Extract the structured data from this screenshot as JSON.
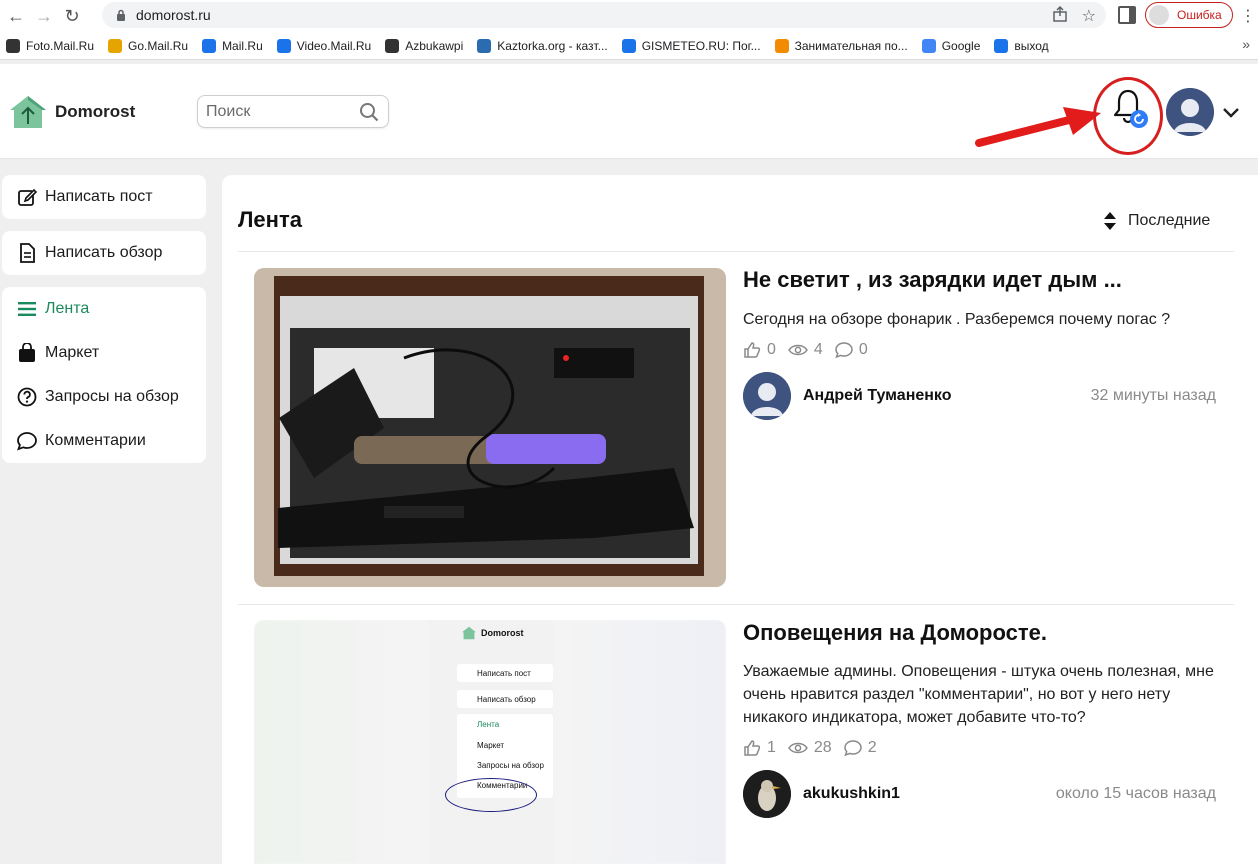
{
  "browser": {
    "url": "domorost.ru",
    "profile_status": "Ошибка",
    "bookmarks": [
      {
        "label": "Foto.Mail.Ru",
        "icon": "camera-icon",
        "color": "#333333"
      },
      {
        "label": "Go.Mail.Ru",
        "icon": "magnifier-icon",
        "color": "#e6a400"
      },
      {
        "label": "Mail.Ru",
        "icon": "at-icon",
        "color": "#1a73e8"
      },
      {
        "label": "Video.Mail.Ru",
        "icon": "video-icon",
        "color": "#1a73e8"
      },
      {
        "label": "Azbukawpi",
        "icon": "azbuka-icon",
        "color": "#333333"
      },
      {
        "label": "Kaztorka.org - казт...",
        "icon": "k-icon",
        "color": "#2b6cb0"
      },
      {
        "label": "GISMETEO.RU: Пог...",
        "icon": "drop-icon",
        "color": "#1a73e8"
      },
      {
        "label": "Занимательная по...",
        "icon": "chat-icon",
        "color": "#f28b00"
      },
      {
        "label": "Google",
        "icon": "google-icon",
        "color": "#4285f4"
      },
      {
        "label": "выход",
        "icon": "at-icon",
        "color": "#1a73e8"
      }
    ]
  },
  "header": {
    "brand": "Domorost",
    "search_placeholder": "Поиск",
    "accent_color": "#1a8a5c",
    "notification_badge_color": "#2e7cf6"
  },
  "sidebar": {
    "write_post": "Написать пост",
    "write_review": "Написать обзор",
    "nav": [
      {
        "label": "Лента",
        "icon": "list-icon",
        "active": true
      },
      {
        "label": "Маркет",
        "icon": "bag-icon",
        "active": false
      },
      {
        "label": "Запросы на обзор",
        "icon": "question-icon",
        "active": false
      },
      {
        "label": "Комментарии",
        "icon": "comment-icon",
        "active": false
      }
    ]
  },
  "feed": {
    "title": "Лента",
    "sort_label": "Последние",
    "posts": [
      {
        "title": "Не светит , из зарядки идет дым ...",
        "excerpt": "Сегодня на обзоре фонарик . Разберемся почему погас ?",
        "likes": "0",
        "views": "4",
        "comments": "0",
        "author": "Андрей Туманенко",
        "time": "32 минуты назад"
      },
      {
        "title": "Оповещения на Доморосте.",
        "excerpt": "Уважаемые админы. Оповещения - штука очень полезная, мне очень нравится раздел \"комментарии\", но вот у него нету никакого индикатора, может добавите что-то?",
        "likes": "1",
        "views": "28",
        "comments": "2",
        "author": "akukushkin1",
        "time": "около 15 часов назад"
      }
    ]
  },
  "screenshot_thumb": {
    "brand": "Domorost",
    "items": [
      "Написать пост",
      "Написать обзор",
      "Лента",
      "Маркет",
      "Запросы на обзор",
      "Комментарии"
    ]
  }
}
